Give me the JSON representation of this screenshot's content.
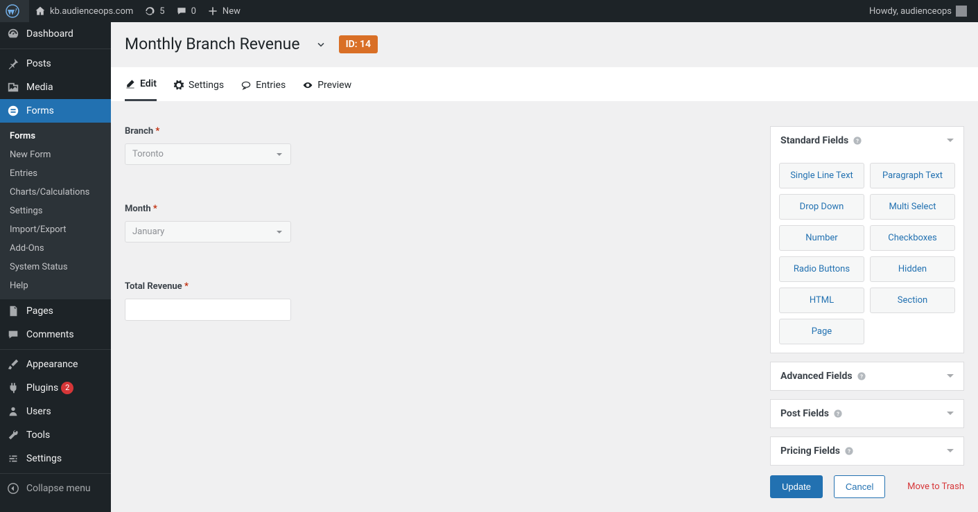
{
  "adminbar": {
    "site_name": "kb.audienceops.com",
    "updates_count": "5",
    "comments_count": "0",
    "new_label": "New",
    "howdy": "Howdy, audienceops"
  },
  "sidebar": {
    "dashboard": "Dashboard",
    "posts": "Posts",
    "media": "Media",
    "forms": "Forms",
    "forms_sub": {
      "forms": "Forms",
      "new_form": "New Form",
      "entries": "Entries",
      "charts": "Charts/Calculations",
      "settings": "Settings",
      "import_export": "Import/Export",
      "addons": "Add-Ons",
      "system_status": "System Status",
      "help": "Help"
    },
    "pages": "Pages",
    "comments": "Comments",
    "appearance": "Appearance",
    "plugins": "Plugins",
    "plugins_badge": "2",
    "users": "Users",
    "tools": "Tools",
    "settings": "Settings",
    "collapse": "Collapse menu"
  },
  "header": {
    "title": "Monthly Branch Revenue",
    "id_badge": "ID: 14"
  },
  "tabs": {
    "edit": "Edit",
    "settings": "Settings",
    "entries": "Entries",
    "preview": "Preview"
  },
  "form": {
    "branch_label": "Branch",
    "branch_value": "Toronto",
    "month_label": "Month",
    "month_value": "January",
    "revenue_label": "Total Revenue"
  },
  "panels": {
    "standard": {
      "title": "Standard Fields",
      "fields": [
        "Single Line Text",
        "Paragraph Text",
        "Drop Down",
        "Multi Select",
        "Number",
        "Checkboxes",
        "Radio Buttons",
        "Hidden",
        "HTML",
        "Section",
        "Page"
      ]
    },
    "advanced": {
      "title": "Advanced Fields"
    },
    "post": {
      "title": "Post Fields"
    },
    "pricing": {
      "title": "Pricing Fields"
    }
  },
  "actions": {
    "update": "Update",
    "cancel": "Cancel",
    "trash": "Move to Trash"
  }
}
